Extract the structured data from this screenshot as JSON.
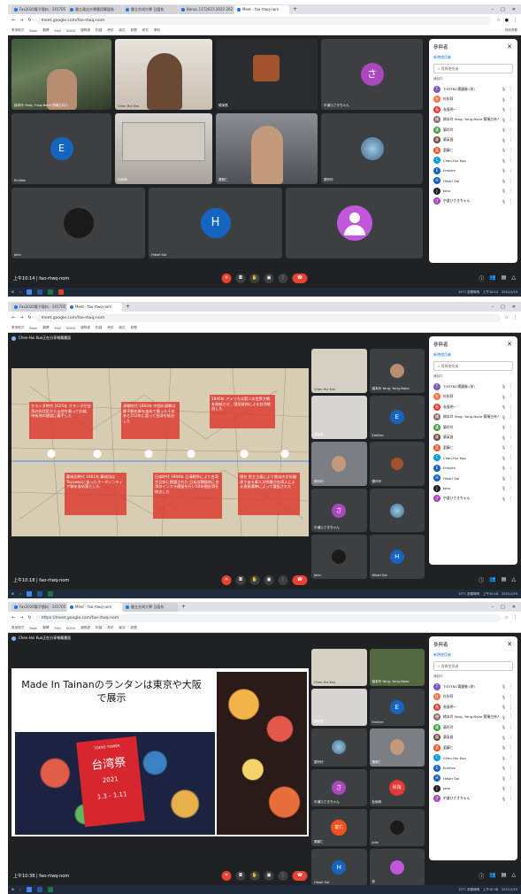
{
  "tabs": [
    {
      "label": "Fax2020電子版料 - 2017057019"
    },
    {
      "label": "國立政治大學應用華語系"
    },
    {
      "label": "國立台灣大學 日語系"
    },
    {
      "label": "Bonus 1172021-2022 2021"
    },
    {
      "label": "Meet - fao-rtwq-nom",
      "active": true
    }
  ],
  "url_1": "meet.google.com/fao-rtwq-nom",
  "url_3": "https://meet.google.com/fao-rtwq-nom",
  "bookmarks": [
    "應用程式",
    "Book",
    "翻譯",
    "Mail",
    "NOKU",
    "國際處",
    "校園",
    "考試",
    "論文",
    "新聞",
    "研究",
    "學校",
    "其他書籤"
  ],
  "meeting_code": "fao-rtwq-nom",
  "panel": {
    "title": "參與者",
    "add_label": "新增使用者",
    "search_placeholder": "搜尋使用者",
    "group_label": "通話中"
  },
  "participants": [
    {
      "name": "TOOTNO黃婕勝 (你)",
      "initial": "T",
      "color": "#7e57c2"
    },
    {
      "name": "杜秋莉",
      "initial": "杜",
      "color": "#ff7043"
    },
    {
      "name": "長島明一",
      "initial": "長",
      "color": "#e53935"
    },
    {
      "name": "橋本玲 Yang, Yung-Nane 簡稱主持人",
      "initial": "橋",
      "color": "#8d6e63"
    },
    {
      "name": "蘭玲玲",
      "initial": "蘭",
      "color": "#43a047"
    },
    {
      "name": "蘭英昌",
      "initial": "蘭",
      "color": "#6d4c41"
    },
    {
      "name": "蕭藤仁",
      "initial": "蕭",
      "color": "#f4511e"
    },
    {
      "name": "Chen-Hui Kuo",
      "initial": "C",
      "color": "#039be5"
    },
    {
      "name": "Emilien",
      "initial": "E",
      "color": "#1565c0"
    },
    {
      "name": "Hikari Sai",
      "initial": "H",
      "color": "#1565c0"
    },
    {
      "name": "John",
      "initial": "J",
      "color": "#212121"
    },
    {
      "name": "中道ひさきちゃん",
      "initial": "さ",
      "color": "#ab47bc"
    }
  ],
  "shot1": {
    "time": "上午10:14",
    "meeting_line": "上午10:14 | fao-rtwq-nom",
    "tiles": [
      {
        "name": "橋本玲 Yang, Yung-Nane 簡稱主持人"
      },
      {
        "name": "Chen-Hui Kuo"
      },
      {
        "name": "蘭英昌"
      },
      {
        "name": "中道ひさきちゃん",
        "initial": "さ"
      },
      {
        "name": "Emilien",
        "initial": "E"
      },
      {
        "name": "杜秋莉"
      },
      {
        "name": "蕭藤仁"
      },
      {
        "name": "蘭玲玲"
      },
      {
        "name": "John"
      },
      {
        "name": "Hikari Sai",
        "initial": "H"
      },
      {
        "name": ""
      }
    ]
  },
  "shot2": {
    "presenter": "Chen-Hui Kuo正在分享螢幕畫面",
    "time": "上午10:18",
    "meeting_line": "上午10:18 | fao-rtwq-nom",
    "slide_boxes": [
      "オランダ時代 1625年 オランダが台湾の先住民から土地を買ってお城、市街地の建設に着手した",
      "清朝時代 1683年 中国の清朝は鄭子朝の軍を攻めて勝ったそのあと212年に渡って台湾を統治した",
      "1945年 アメリカは第二次世界大戦を終結させ、国民政府による台湾統治した",
      "鄭成功時代 1661年 鄭成功はTayowanにあったオーディンティア城を攻め落とした",
      "日本時代 1894年 日清戦争により台湾が日本に割譲された 日本は積極的に台湾のインフラ建設を行い50年間台湾を統治した",
      "現在 民主主義により独自の文化継承である華人文明最が台湾人による直接選挙によって選出された"
    ],
    "strip": [
      {
        "name": "橋本玲 Yang, Yung-Nane"
      },
      {
        "name": "蘭英昌"
      },
      {
        "name": "Emilien",
        "initial": "E"
      },
      {
        "name": "蘭玲玲"
      },
      {
        "name": "中道ひさきちゃん",
        "initial": "さ"
      },
      {
        "name": "蘭玲玲"
      },
      {
        "name": "John"
      },
      {
        "name": "Hikari Sai",
        "initial": "H"
      },
      {
        "name": "杜秋莉",
        "initial": "科院"
      },
      {
        "name": "你"
      }
    ]
  },
  "shot3": {
    "presenter": "Chen-Hui Kuo正在分享螢幕畫面",
    "time": "上午10:38",
    "meeting_line": "上午10:38 | fao-rtwq-nom",
    "slide_title": "Made In Tainanのランタンは東京や大阪で展示",
    "poster_top": "TOKYO TOWER",
    "poster_title": "台湾祭",
    "poster_year": "2021",
    "poster_dates": "1.3 - 1.11",
    "strip": [
      {
        "name": "Chen-Hui Kuo"
      },
      {
        "name": "橋本玲 Yang, Yung-Nane"
      },
      {
        "name": "蘭英昌"
      },
      {
        "name": "Emilien",
        "initial": "E"
      },
      {
        "name": "蘭玲玲"
      },
      {
        "name": "蕭藤仁"
      },
      {
        "name": "中道ひさきちゃん",
        "initial": "さ"
      },
      {
        "name": "杜秋莉",
        "initial": "科院"
      },
      {
        "name": "蕭藤仁",
        "initial": "富仁"
      },
      {
        "name": "John"
      },
      {
        "name": "Hikari Sai",
        "initial": "H"
      },
      {
        "name": "你"
      }
    ]
  },
  "taskbar": {
    "weather": "15°C 多雲時晴",
    "date": "2021/1/19"
  },
  "colors": {
    "meet_bg": "#202124",
    "accent": "#1a73e8",
    "end_call": "#ea4335"
  }
}
